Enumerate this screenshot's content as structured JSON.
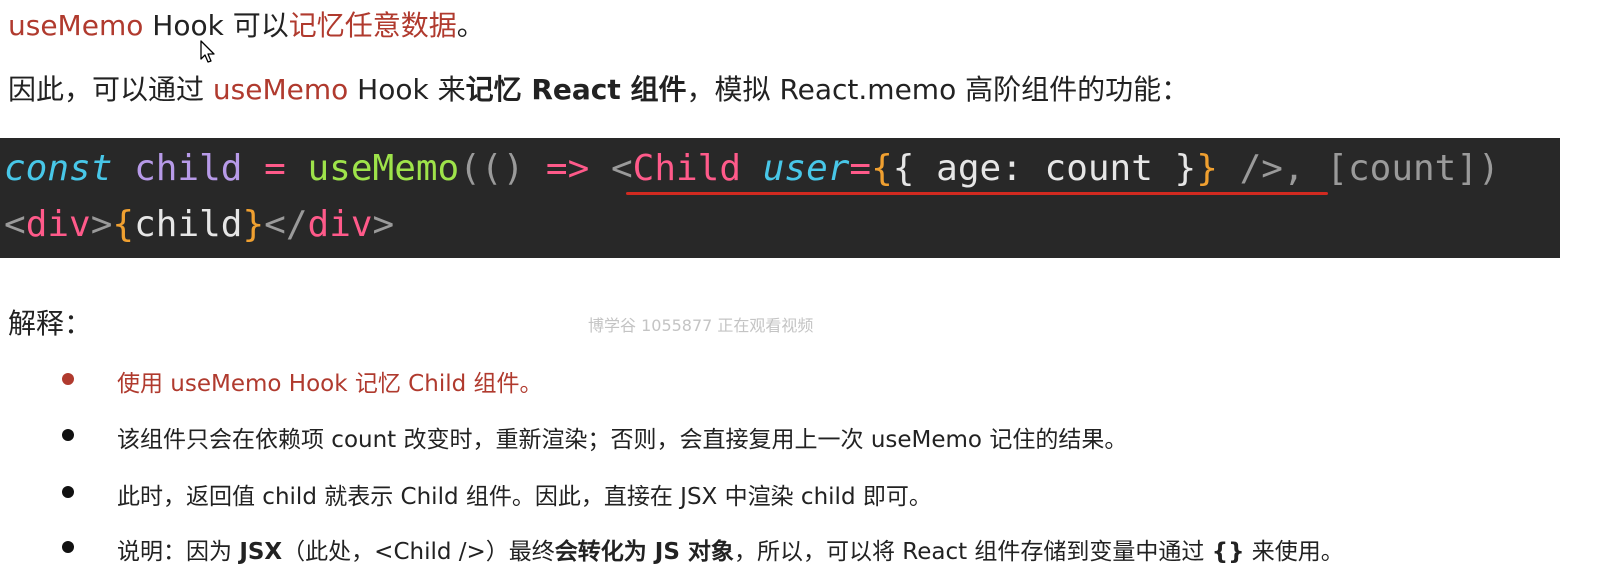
{
  "intro": {
    "l1_a": "useMemo",
    "l1_b": " Hook 可以",
    "l1_c": "记忆任意数据",
    "l1_d": "。",
    "l2_a": "因此，可以通过 ",
    "l2_b": "useMemo",
    "l2_c": " Hook 来",
    "l2_d": "记忆 React 组件",
    "l2_e": "，模拟 React.memo 高阶组件的功能："
  },
  "code": {
    "line1": {
      "t1": "const",
      "t2": " ",
      "t3": "child",
      "t4": " ",
      "t5": "=",
      "t6": " ",
      "t7": "useMemo",
      "t8": "(() ",
      "t9": "=>",
      "t10": " ",
      "t11": "<",
      "t12": "Child",
      "t13": " ",
      "t14": "user",
      "t15": "=",
      "t16": "{",
      "t17": "{ age: count }",
      "t18": "}",
      "t19": " />",
      "t20": ", [count])"
    },
    "line2": {
      "t1": "<",
      "t2": "div",
      "t3": ">",
      "t4": "{",
      "t5": "child",
      "t6": "}",
      "t7": "</",
      "t8": "div",
      "t9": ">"
    }
  },
  "explain_label": "解释：",
  "watermark": "博学谷 1055877 正在观看视频",
  "bullets": {
    "b1": "使用 useMemo Hook 记忆 Child 组件。",
    "b2": "该组件只会在依赖项 count 改变时，重新渲染；否则，会直接复用上一次 useMemo 记住的结果。",
    "b3": "此时，返回值 child 就表示 Child 组件。因此，直接在 JSX 中渲染 child 即可。",
    "b4": {
      "a": "说明：因为 ",
      "b": "JSX",
      "c": "（此处，<Child />）最终",
      "d": "会转化为 JS 对象",
      "e": "，所以，可以将 React 组件存储到变量中通过 ",
      "f": "{}",
      "g": " 来使用。"
    }
  },
  "colors": {
    "accent_red": "#b03a2e",
    "code_bg": "#282828",
    "underline": "#d12a20"
  },
  "icons": {
    "cursor": "mouse-pointer-icon"
  }
}
